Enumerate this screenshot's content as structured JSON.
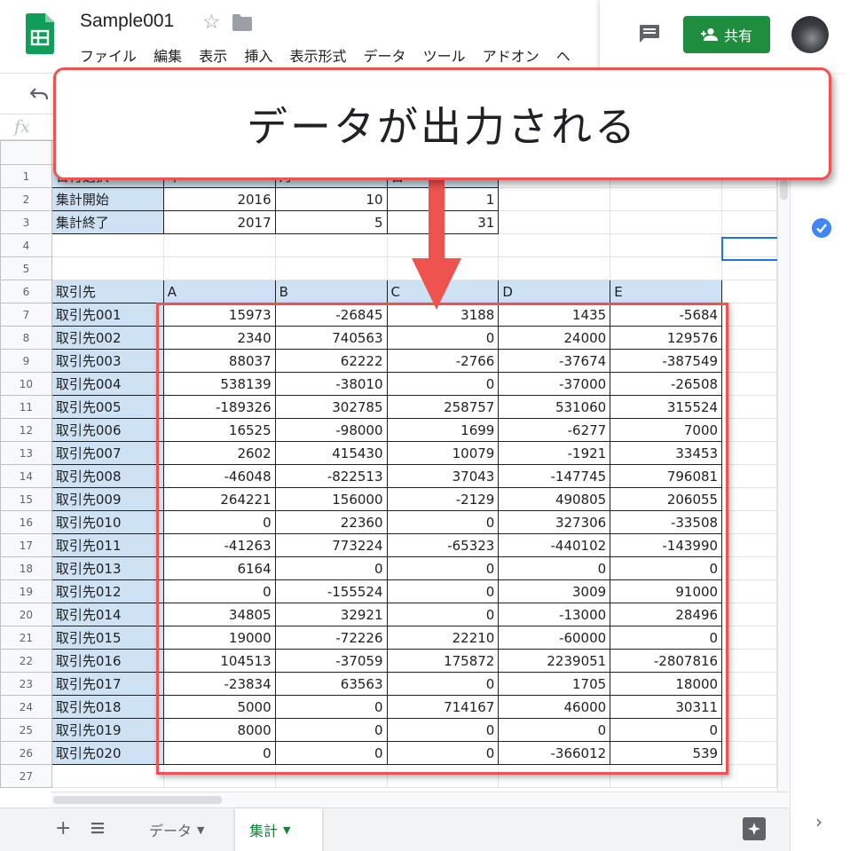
{
  "header": {
    "doc_title": "Sample001",
    "menu": [
      "ファイル",
      "編集",
      "表示",
      "挿入",
      "表示形式",
      "データ",
      "ツール",
      "アドオン",
      "ヘ"
    ],
    "share_label": "共有",
    "colors": {
      "share": "#1e8e3e",
      "sheets_logo": "#0f9d58"
    }
  },
  "formula_bar": {
    "fx": "fx"
  },
  "sheet": {
    "row_numbers": [
      "1",
      "2",
      "3",
      "4",
      "5",
      "6",
      "7",
      "8",
      "9",
      "10",
      "11",
      "12",
      "13",
      "14",
      "15",
      "16",
      "17",
      "18",
      "19",
      "20",
      "21",
      "22",
      "23",
      "24",
      "25",
      "26",
      "27"
    ],
    "date_table": {
      "header": [
        "日付選択",
        "年",
        "月",
        "日"
      ],
      "rows": [
        {
          "label": "集計開始",
          "values": [
            "2016",
            "10",
            "1"
          ]
        },
        {
          "label": "集計終了",
          "values": [
            "2017",
            "5",
            "31"
          ]
        }
      ]
    },
    "data_table": {
      "header": [
        "取引先",
        "A",
        "B",
        "C",
        "D",
        "E"
      ],
      "rows": [
        {
          "label": "取引先001",
          "values": [
            "15973",
            "-26845",
            "3188",
            "1435",
            "-5684"
          ]
        },
        {
          "label": "取引先002",
          "values": [
            "2340",
            "740563",
            "0",
            "24000",
            "129576"
          ]
        },
        {
          "label": "取引先003",
          "values": [
            "88037",
            "62222",
            "-2766",
            "-37674",
            "-387549"
          ]
        },
        {
          "label": "取引先004",
          "values": [
            "538139",
            "-38010",
            "0",
            "-37000",
            "-26508"
          ]
        },
        {
          "label": "取引先005",
          "values": [
            "-189326",
            "302785",
            "258757",
            "531060",
            "315524"
          ]
        },
        {
          "label": "取引先006",
          "values": [
            "16525",
            "-98000",
            "1699",
            "-6277",
            "7000"
          ]
        },
        {
          "label": "取引先007",
          "values": [
            "2602",
            "415430",
            "10079",
            "-1921",
            "33453"
          ]
        },
        {
          "label": "取引先008",
          "values": [
            "-46048",
            "-822513",
            "37043",
            "-147745",
            "796081"
          ]
        },
        {
          "label": "取引先009",
          "values": [
            "264221",
            "156000",
            "-2129",
            "490805",
            "206055"
          ]
        },
        {
          "label": "取引先010",
          "values": [
            "0",
            "22360",
            "0",
            "327306",
            "-33508"
          ]
        },
        {
          "label": "取引先011",
          "values": [
            "-41263",
            "773224",
            "-65323",
            "-440102",
            "-143990"
          ]
        },
        {
          "label": "取引先013",
          "values": [
            "6164",
            "0",
            "0",
            "0",
            "0"
          ]
        },
        {
          "label": "取引先012",
          "values": [
            "0",
            "-155524",
            "0",
            "3009",
            "91000"
          ]
        },
        {
          "label": "取引先014",
          "values": [
            "34805",
            "32921",
            "0",
            "-13000",
            "28496"
          ]
        },
        {
          "label": "取引先015",
          "values": [
            "19000",
            "-72226",
            "22210",
            "-60000",
            "0"
          ]
        },
        {
          "label": "取引先016",
          "values": [
            "104513",
            "-37059",
            "175872",
            "2239051",
            "-2807816"
          ]
        },
        {
          "label": "取引先017",
          "values": [
            "-23834",
            "63563",
            "0",
            "1705",
            "18000"
          ]
        },
        {
          "label": "取引先018",
          "values": [
            "5000",
            "0",
            "714167",
            "46000",
            "30311"
          ]
        },
        {
          "label": "取引先019",
          "values": [
            "8000",
            "0",
            "0",
            "0",
            "0"
          ]
        },
        {
          "label": "取引先020",
          "values": [
            "0",
            "0",
            "0",
            "-366012",
            "539"
          ]
        }
      ]
    }
  },
  "tabs": [
    {
      "label": "データ",
      "active": false
    },
    {
      "label": "集計",
      "active": true
    }
  ],
  "annotation": {
    "callout_text": "データが出力される",
    "color": "#ef5350"
  }
}
